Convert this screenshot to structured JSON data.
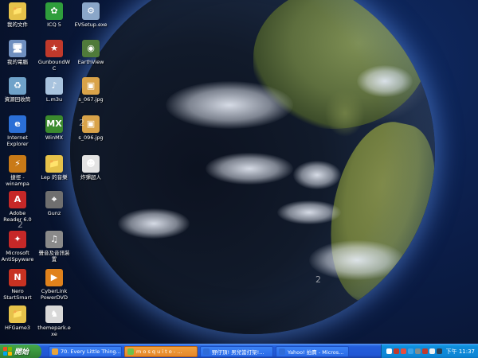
{
  "desktop": {
    "icons": [
      {
        "label": "我的文件",
        "glyph": "📁",
        "color": "#e6c24a"
      },
      {
        "label": "ICQ 5",
        "glyph": "✿",
        "color": "#2f9e3c"
      },
      {
        "label": "EVSetup.exe",
        "glyph": "⚙",
        "color": "#8aa6c8"
      },
      {
        "label": "我的電腦",
        "glyph": "🖥",
        "color": "#6f8fbf"
      },
      {
        "label": "GunboundWC",
        "glyph": "★",
        "color": "#c0392b"
      },
      {
        "label": "EarthView",
        "glyph": "◉",
        "color": "#4f7a3a"
      },
      {
        "label": "資源回收筒",
        "glyph": "♻",
        "color": "#6fa2c9"
      },
      {
        "label": "L.m3u",
        "glyph": "♪",
        "color": "#a8c3de"
      },
      {
        "label": "s_067.jpg",
        "glyph": "▣",
        "color": "#d9a349"
      },
      {
        "label": "Internet Explorer",
        "glyph": "e",
        "color": "#2b6fd6"
      },
      {
        "label": "WinMX",
        "glyph": "MX",
        "color": "#3b8a2e"
      },
      {
        "label": "s_096.jpg",
        "glyph": "▣",
        "color": "#d9a349"
      },
      {
        "label": "捷徑 - winampa",
        "glyph": "⚡",
        "color": "#c97a17"
      },
      {
        "label": "Lep 的音樂",
        "glyph": "📁",
        "color": "#e6c24a"
      },
      {
        "label": "炸彈超人",
        "glyph": "☻",
        "color": "#e3e3e3"
      },
      {
        "label": "Adobe Reader 6.0",
        "glyph": "A",
        "color": "#c62828"
      },
      {
        "label": "Gunz",
        "glyph": "⌖",
        "color": "#6f6f6f"
      },
      {
        "label": "Microsoft AntiSpyware",
        "glyph": "✦",
        "color": "#c62828"
      },
      {
        "label": "聲音及音訊裝置",
        "glyph": "♫",
        "color": "#8a8a8a"
      },
      {
        "label": "Nero StartSmart",
        "glyph": "N",
        "color": "#c83222"
      },
      {
        "label": "CyberLink PowerDVD",
        "glyph": "▶",
        "color": "#e0821c"
      },
      {
        "label": "HFGame3",
        "glyph": "📁",
        "color": "#e6c24a"
      },
      {
        "label": "themepark.exe",
        "glyph": "♞",
        "color": "#d8d8d8"
      }
    ],
    "overlay_numbers": [
      "2",
      "2",
      "2"
    ]
  },
  "taskbar": {
    "start_label": "開始",
    "tasks": [
      {
        "label": "70. Every Little Thing...",
        "active": false,
        "icon_color": "#e8a43a"
      },
      {
        "label": "m o s q u i t o - ...",
        "active": true,
        "icon_color": "#6cc04a"
      },
      {
        "label": "野仔頂! 男兒當打架!...",
        "active": false,
        "icon_color": "#2e6bd8"
      },
      {
        "label": "Yahoo! 拍賣 - Micros...",
        "active": false,
        "icon_color": "#2e6bd8"
      }
    ],
    "tray_icon_colors": [
      "#ffffff",
      "#c0392b",
      "#e74c3c",
      "#3aa1e6",
      "#7f8c8d",
      "#c0392b",
      "#ecf0f1",
      "#2c3e50"
    ],
    "clock": "下午 11:37"
  }
}
